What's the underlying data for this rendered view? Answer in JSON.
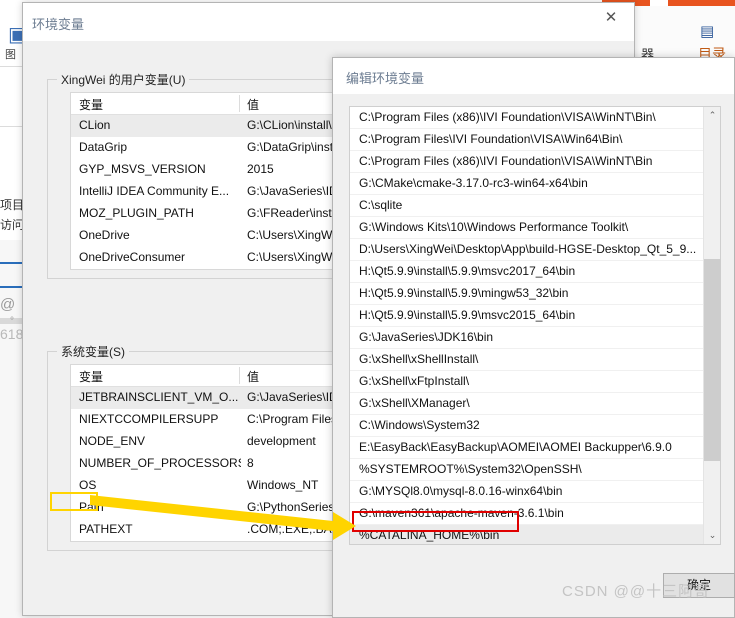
{
  "background": {
    "left_panel": {
      "label_1": "图",
      "label_2": "项目",
      "label_3": "访问",
      "at_symbol": "@",
      "dot": "°",
      "number": "618"
    },
    "ribbon": {
      "icon_a": "▤",
      "icon_b": "目录",
      "icon_c": "器"
    }
  },
  "env_dialog": {
    "title": "环境变量",
    "close_label": "✕",
    "user_group_label": "XingWei 的用户变量(U)",
    "system_group_label": "系统变量(S)",
    "columns": {
      "variable": "变量",
      "value": "值"
    },
    "user_variables": [
      {
        "name": "CLion",
        "value": "G:\\CLion\\install\\CLi"
      },
      {
        "name": "DataGrip",
        "value": "G:\\DataGrip\\install\\"
      },
      {
        "name": "GYP_MSVS_VERSION",
        "value": "2015"
      },
      {
        "name": "IntelliJ IDEA Community E...",
        "value": "G:\\JavaSeries\\IDEA"
      },
      {
        "name": "MOZ_PLUGIN_PATH",
        "value": "G:\\FReader\\install\\"
      },
      {
        "name": "OneDrive",
        "value": "C:\\Users\\XingWei\\"
      },
      {
        "name": "OneDriveConsumer",
        "value": "C:\\Users\\XingWei\\"
      }
    ],
    "system_variables": [
      {
        "name": "JETBRAINSCLIENT_VM_O...",
        "value": "G:\\JavaSeries\\IDEA"
      },
      {
        "name": "NIEXTCCOMPILERSUPP",
        "value": "C:\\Program Files (x"
      },
      {
        "name": "NODE_ENV",
        "value": "development"
      },
      {
        "name": "NUMBER_OF_PROCESSORS",
        "value": "8"
      },
      {
        "name": "OS",
        "value": "Windows_NT"
      },
      {
        "name": "Path",
        "value": "G:\\PythonSeries\\ins"
      },
      {
        "name": "PATHEXT",
        "value": ".COM;.EXE;.BAT;.CM"
      }
    ]
  },
  "edit_dialog": {
    "title": "编辑环境变量",
    "ok_button": "确定",
    "scroll_up": "⌃",
    "scroll_down": "⌄",
    "path_entries": [
      "C:\\Program Files (x86)\\IVI Foundation\\VISA\\WinNT\\Bin\\",
      "C:\\Program Files\\IVI Foundation\\VISA\\Win64\\Bin\\",
      "C:\\Program Files (x86)\\IVI Foundation\\VISA\\WinNT\\Bin",
      "G:\\CMake\\cmake-3.17.0-rc3-win64-x64\\bin",
      "C:\\sqlite",
      "G:\\Windows Kits\\10\\Windows Performance Toolkit\\",
      "D:\\Users\\XingWei\\Desktop\\App\\build-HGSE-Desktop_Qt_5_9...",
      "H:\\Qt5.9.9\\install\\5.9.9\\msvc2017_64\\bin",
      "H:\\Qt5.9.9\\install\\5.9.9\\mingw53_32\\bin",
      "H:\\Qt5.9.9\\install\\5.9.9\\msvc2015_64\\bin",
      "G:\\JavaSeries\\JDK16\\bin",
      "G:\\xShell\\xShellInstall\\",
      "G:\\xShell\\xFtpInstall\\",
      "G:\\xShell\\XManager\\",
      "C:\\Windows\\System32",
      "E:\\EasyBack\\EasyBackup\\AOMEI\\AOMEI Backupper\\6.9.0",
      "%SYSTEMROOT%\\System32\\OpenSSH\\",
      "G:\\MYSQl8.0\\mysql-8.0.16-winx64\\bin",
      "G:\\maven361\\apache-maven-3.6.1\\bin",
      "%CATALINA_HOME%\\bin"
    ],
    "selected_entry_index": 19
  },
  "annotations": {
    "highlight_source": "Path",
    "highlight_target": "%CATALINA_HOME%\\bin",
    "yellow_color": "#ffd400",
    "red_color": "#e00000"
  },
  "watermark": "CSDN @@十三阿哥"
}
